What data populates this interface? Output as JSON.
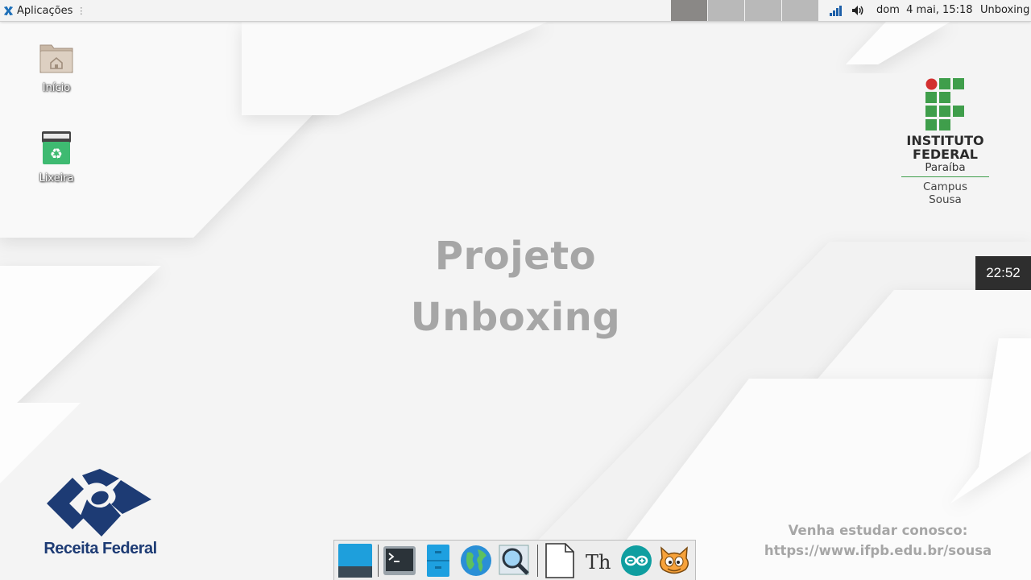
{
  "top_panel": {
    "apps_menu_label": "Aplicações",
    "apps_menu_dots": "⋮",
    "clock": "dom  4 mai, 15:18",
    "window_title": "Unboxing",
    "workspaces": 4,
    "active_workspace": 1
  },
  "desktop_icons": [
    {
      "label": "Início",
      "icon": "home-folder-icon"
    },
    {
      "label": "Lixeira",
      "icon": "trash-icon"
    }
  ],
  "project_title": {
    "line1": "Projeto",
    "line2": "Unboxing"
  },
  "if_logo": {
    "line1": "INSTITUTO",
    "line2": "FEDERAL",
    "state": "Paraíba",
    "campus": "Campus",
    "city": "Sousa"
  },
  "side_clock": "22:52",
  "receita_logo": {
    "name": "Receita Federal"
  },
  "promo": {
    "line1": "Venha estudar conosco:",
    "line2": "https://www.ifpb.edu.br/sousa"
  },
  "dock": {
    "items": [
      "show-desktop-icon",
      "terminal-icon",
      "file-manager-icon",
      "web-browser-icon",
      "app-finder-icon",
      "document-icon",
      "thonny-icon",
      "arduino-icon",
      "scratch-icon"
    ]
  },
  "colors": {
    "title_gray": "#a6a6a6",
    "if_green": "#3f9e4b",
    "if_red": "#d32f2f",
    "receita_blue": "#1d3b74",
    "panel_bg": "#f3f3f3"
  }
}
